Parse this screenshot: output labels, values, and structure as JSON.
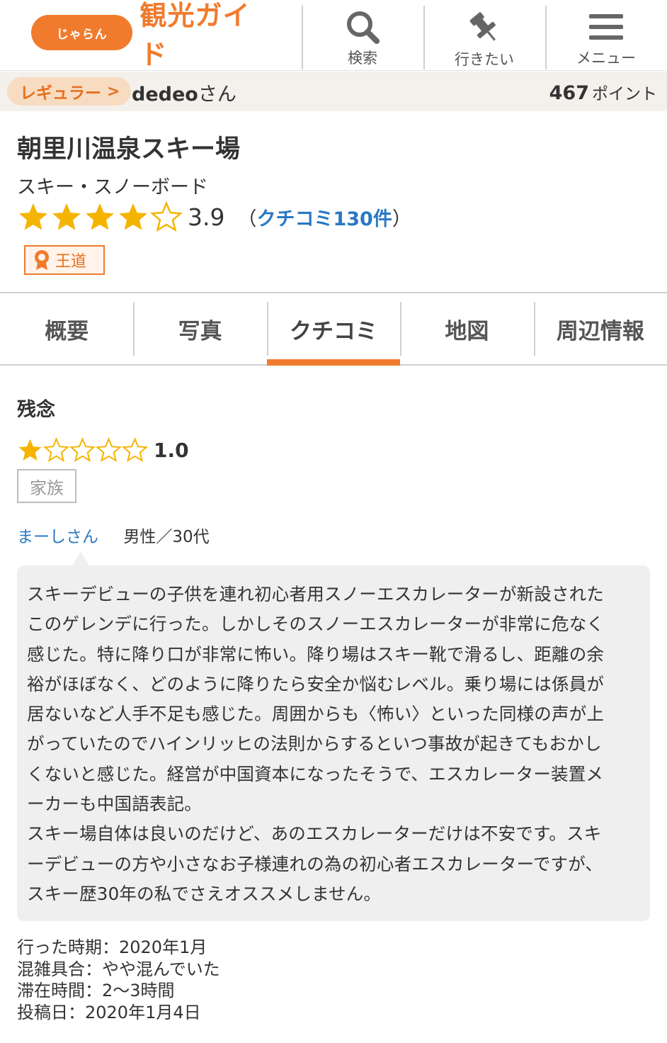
{
  "header": {
    "logo_mark": "じゃらん",
    "logo_text": "観光ガイド",
    "nav": [
      {
        "label": "検索",
        "icon": "search-icon"
      },
      {
        "label": "行きたい",
        "icon": "pin-icon"
      },
      {
        "label": "メニュー",
        "icon": "hamburger-menu-icon"
      }
    ]
  },
  "user": {
    "rank": "レギュラー",
    "name": "dedeo",
    "suffix": "さん",
    "points": "467",
    "points_unit": "ポイント"
  },
  "spot": {
    "title": "朝里川温泉スキー場",
    "category": "スキー・スノーボード",
    "rating": "3.9",
    "rating_stars": 3.9,
    "review_link_open": "（",
    "review_link": "クチコミ130件",
    "review_link_close": "）",
    "badge": "王道"
  },
  "tabs": [
    "概要",
    "写真",
    "クチコミ",
    "地図",
    "周辺情報"
  ],
  "active_tab": "クチコミ",
  "review": {
    "title": "残念",
    "score": "1.0",
    "score_stars": 1,
    "tag": "家族",
    "reviewer_name": "まーしさん",
    "reviewer_meta": "男性／30代",
    "body": "スキーデビューの子供を連れ初心者用スノーエスカレーターが新設された\nこのゲレンデに行った。しかしそのスノーエスカレーターが非常に危なく\n感じた。特に降り口が非常に怖い。降り場はスキー靴で滑るし、距離の余\n裕がほぼなく、どのように降りたら安全か悩むレベル。乗り場には係員が\n居ないなど人手不足も感じた。周囲からも〈怖い〉といった同様の声が上\nがっていたのでハインリッヒの法則からするといつ事故が起きてもおかし\nくないと感じた。経営が中国資本になったそうで、エスカレーター装置メ\nーカーも中国語表記。\nスキー場自体は良いのだけど、あのエスカレーターだけは不安です。スキ\nーデビューの方や小さなお子様連れの為の初心者エスカレーターですが、\nスキー歴30年の私でさえオススメしません。",
    "meta": {
      "visited": "行った時期：2020年1月",
      "crowd": "混雑具合：やや混んでいた",
      "duration": "滞在時間：2〜3時間",
      "posted": "投稿日：2020年1月4日"
    }
  },
  "colors": {
    "brand": "#f07b2d",
    "star": "#f5b400",
    "link": "#2a78c4"
  }
}
